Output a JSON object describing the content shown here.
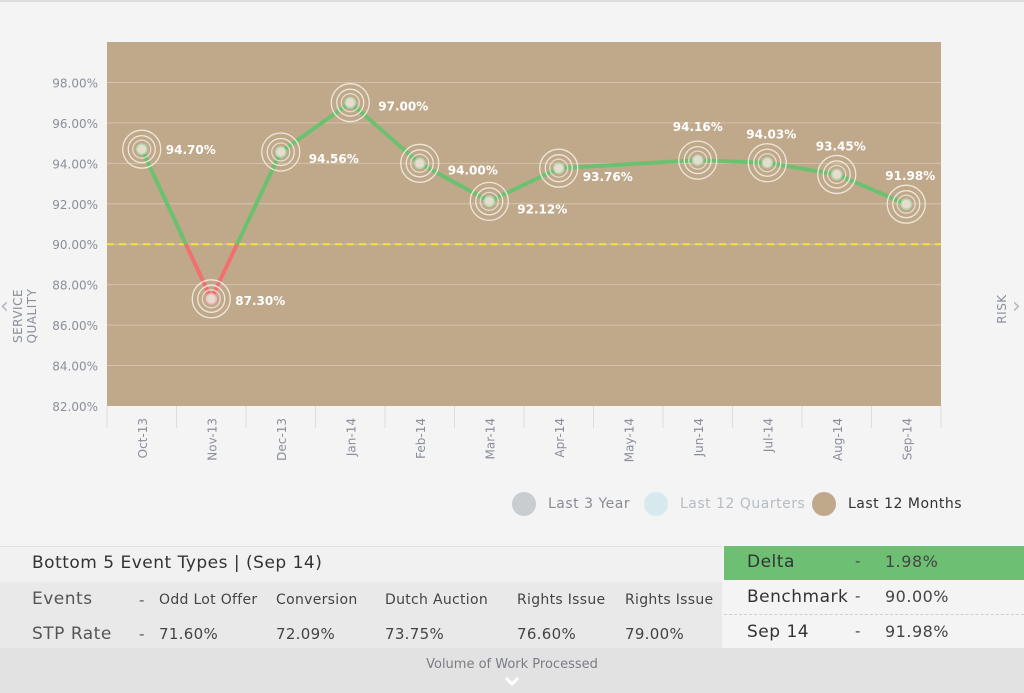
{
  "side": {
    "left_label": "SERVICE QUALITY",
    "right_label": "RISK"
  },
  "colors": {
    "plot_bg": "#c0a98b",
    "good_line": "#6cc170",
    "bad_line": "#f07070",
    "threshold": "#f5e23a",
    "delta_bg": "#6dc073"
  },
  "chart_data": {
    "type": "line",
    "categories": [
      "Oct-13",
      "Nov-13",
      "Dec-13",
      "Jan-14",
      "Feb-14",
      "Mar-14",
      "Apr-14",
      "May-14",
      "Jun-14",
      "Jul-14",
      "Aug-14",
      "Sep-14"
    ],
    "series": [
      {
        "values": [
          94.7,
          87.3,
          94.56,
          97.0,
          94.0,
          92.12,
          93.76,
          null,
          94.16,
          94.03,
          93.45,
          91.98
        ],
        "labels": [
          "94.70%",
          "87.30%",
          "94.56%",
          "97.00%",
          "94.00%",
          "92.12%",
          "93.76%",
          "",
          "94.16%",
          "94.03%",
          "93.45%",
          "91.98%"
        ]
      }
    ],
    "threshold": 90.0,
    "ylim": [
      82,
      100
    ],
    "yticks": [
      82,
      84,
      86,
      88,
      90,
      92,
      94,
      96,
      98
    ],
    "ytick_labels": [
      "82.00%",
      "84.00%",
      "86.00%",
      "88.00%",
      "90.00%",
      "92.00%",
      "94.00%",
      "96.00%",
      "98.00%"
    ],
    "ylabel": "SERVICE QUALITY",
    "grid": true
  },
  "legend": [
    {
      "label": "Last 3 Year",
      "color": "#c9ccd1",
      "text_color": "#888c93"
    },
    {
      "label": "Last 12 Quarters",
      "color": "#d6eaee",
      "text_color": "#b6bcc2"
    },
    {
      "label": "Last 12 Months",
      "color": "#c0a98b",
      "text_color": "#333333"
    }
  ],
  "events": {
    "title": "Bottom 5 Event Types | (Sep 14)",
    "events_label": "Events",
    "stp_label": "STP Rate",
    "dash": "-",
    "types": [
      "Odd Lot Offer",
      "Conversion",
      "Dutch Auction",
      "Rights Issue",
      "Rights Issue"
    ],
    "rates": [
      "71.60%",
      "72.09%",
      "73.75%",
      "76.60%",
      "79.00%"
    ]
  },
  "stats": [
    {
      "name": "Delta",
      "dash": "-",
      "value": "1.98%"
    },
    {
      "name": "Benchmark",
      "dash": "-",
      "value": "90.00%"
    },
    {
      "name": "Sep 14",
      "dash": "-",
      "value": "91.98%"
    }
  ],
  "footer": {
    "label": "Volume of Work Processed"
  }
}
